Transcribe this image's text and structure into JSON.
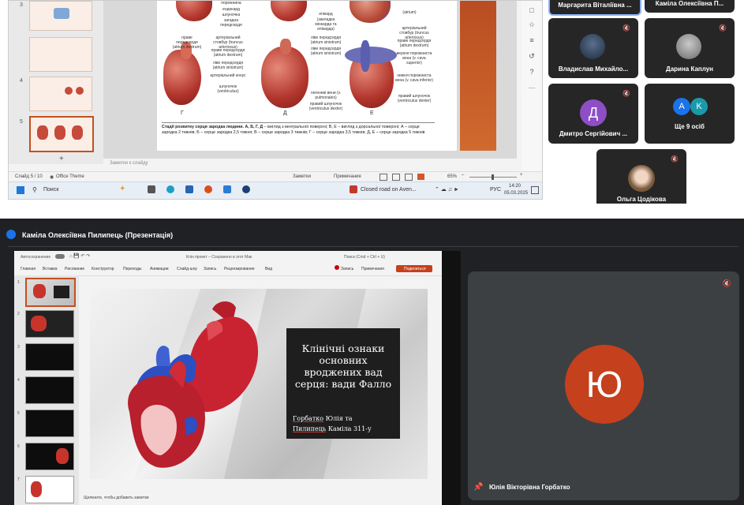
{
  "top": {
    "thumbnails": [
      "3",
      "4",
      "5"
    ],
    "slide_labels": {
      "top_row": [
        "порожнина",
        "ендокард",
        "шлуночка",
        "загадна передсердя",
        "епікард",
        "(закладка міокарда та епікарда)",
        "(atrium)"
      ],
      "left": [
        "праве передсердя (atrium dextrum)",
        "артеріальний стовбур (truncus arteriosus)",
        "праве передсердя (atrium dextrum)",
        "ліве передсердя (atrium sinistrum)",
        "артеріальний конус",
        "шлуночок (ventriculus)"
      ],
      "middle": [
        "ліве передсердя (atrium sinistrum)",
        "ліве передсердя (atrium sinistrum)",
        "легеневі вени (v. pulmonales)",
        "правий шлуночок (ventriculus dexter)"
      ],
      "right": [
        "артеріальний стовбур (truncus arteriosus)",
        "праве передсердя (atrium dextrum)",
        "верхня порожниста вена (v. cava superior)",
        "нижня порожниста вена (v. cava inferior)",
        "правий шлуночок (ventriculus dexter)"
      ],
      "letters": [
        "Г",
        "Д",
        "Е"
      ]
    },
    "caption_bold": "Стадії розвитку серця зародка людини. А, Б, Г, Д",
    "caption_rest": " – вигляд з вентральної поверхні; В, Е – вигляд з дорсальної поверхні; А – серце зародка 2 тижнів; Б – серце зародка 2,5 тижня; В – серце зародка 3 тижнів; Г – серце зародка 3,5 тижнів; Д, Е – серце зародка 5 тижнів",
    "notes_placeholder": "Заметки к слайду",
    "status": {
      "slide": "Слайд 5 / 10",
      "theme": "Office Theme",
      "notes": "Заметки",
      "comments": "Примечания",
      "zoom": "65%"
    },
    "taskbar": {
      "search": "Поиск",
      "news": "Closed road on Aven...",
      "lang": "РУС",
      "time": "14:20",
      "date": "05.03.2025"
    },
    "participants": [
      {
        "name": "Маргарита Віталіївна ...",
        "avatar": ""
      },
      {
        "name": "Каміла Олексіївна П...",
        "avatar": ""
      },
      {
        "name": "Владислав Михайло...",
        "avatar": "photo"
      },
      {
        "name": "Дарина Каплун",
        "avatar": "photo"
      },
      {
        "name": "Дмитро Сергійович ...",
        "avatar": "Д"
      },
      {
        "name": "Ще 9 осіб",
        "avatar": "А К"
      },
      {
        "name": "Ольга Цодікова",
        "avatar": "photo"
      }
    ]
  },
  "bottom": {
    "title": "Каміла Олексіївна Пилипець (Презентація)",
    "powerpoint": {
      "autosave": "Автосохранение",
      "file_title": "Клін проект – Сохранено в этот Мак",
      "search": "Поиск (Cmd + Ctrl + U)",
      "tabs": [
        "Главная",
        "Вставка",
        "Рисование",
        "Конструктор",
        "Переходы",
        "Анимации",
        "Слайд-шоу",
        "Запись",
        "Рецензирование",
        "Вид"
      ],
      "record_label": "Запись",
      "comments_label": "Примечания",
      "share_label": "Поделиться",
      "thumbnail_numbers": [
        "1",
        "2",
        "3",
        "4",
        "5",
        "6",
        "7"
      ],
      "slide_title": "Клінічні ознаки основних вроджених вад серця: вади Фалло",
      "slide_authors_u1": "Горбатко",
      "slide_authors_t1": " Юлія та",
      "slide_authors_u2": "Пилипець",
      "slide_authors_t2": " Каміла 311-у",
      "notes_placeholder": "Щелкните, чтобы добавить заметки"
    },
    "presenter": {
      "initial": "Ю",
      "name": "Юлія Вікторівна Горбатко"
    }
  },
  "colors": {
    "accent_orange": "#c5401c",
    "meet_dark": "#202124",
    "tile_dark": "#262626",
    "avatar_purple": "#8e4ec6",
    "avatar_blue": "#1a73e8",
    "avatar_teal": "#1a9aa8"
  }
}
